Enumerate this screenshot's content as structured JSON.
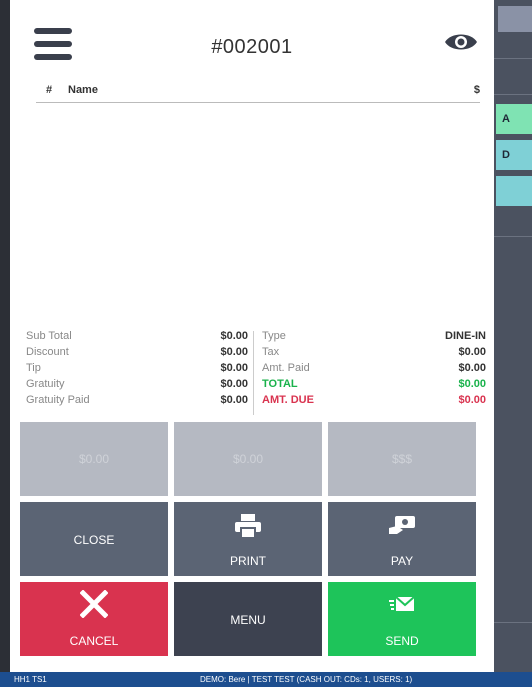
{
  "header": {
    "order_number": "#002001"
  },
  "items_table": {
    "col_number": "#",
    "col_name": "Name",
    "col_price": "$"
  },
  "totals_left": [
    {
      "label": "Sub Total",
      "value": "$0.00"
    },
    {
      "label": "Discount",
      "value": "$0.00"
    },
    {
      "label": "Tip",
      "value": "$0.00"
    },
    {
      "label": "Gratuity",
      "value": "$0.00"
    },
    {
      "label": "Gratuity Paid",
      "value": "$0.00"
    }
  ],
  "totals_right": [
    {
      "label": "Type",
      "value": "DINE-IN"
    },
    {
      "label": "Tax",
      "value": "$0.00"
    },
    {
      "label": "Amt. Paid",
      "value": "$0.00"
    },
    {
      "label": "TOTAL",
      "value": "$0.00"
    },
    {
      "label": "AMT. DUE",
      "value": "$0.00"
    }
  ],
  "quick_tenders": [
    "$0.00",
    "$0.00",
    "$$$"
  ],
  "actions": {
    "close": "CLOSE",
    "print": "PRINT",
    "pay": "PAY",
    "cancel": "CANCEL",
    "menu": "MENU",
    "send": "SEND"
  },
  "right_panel": {
    "btn_a": "A",
    "btn_d": "D"
  },
  "status_bar": {
    "left": "HH1  TS1",
    "center": "DEMO: Bere | TEST TEST (CASH OUT: CDs: 1, USERS: 1)"
  },
  "colors": {
    "total_green": "#19b24b",
    "amt_due_red": "#d9334f",
    "cancel_red": "#d9334f",
    "send_green": "#1ec45a",
    "slate": "#5b6474"
  }
}
